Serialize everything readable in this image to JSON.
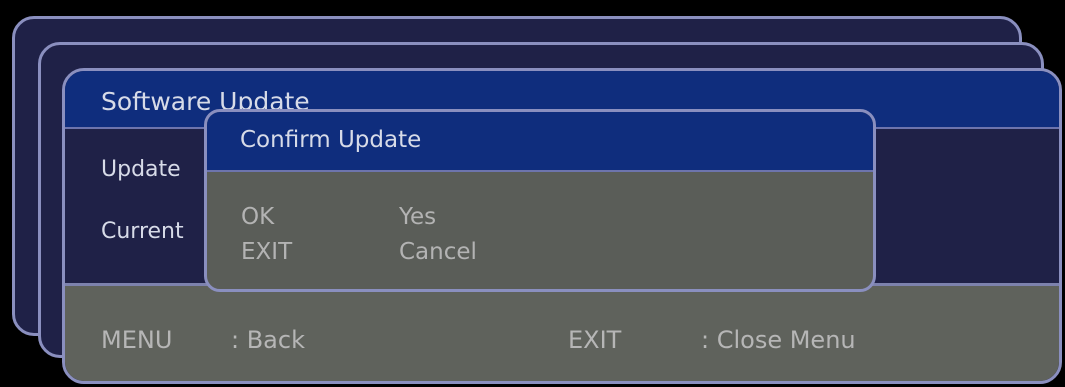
{
  "main_window": {
    "title": "Software Update",
    "rows": [
      "Update",
      "Current"
    ]
  },
  "footer": {
    "menu_key": "MENU",
    "menu_action": ": Back",
    "exit_key": "EXIT",
    "exit_action": ": Close Menu"
  },
  "dialog": {
    "title": "Confirm Update",
    "options": [
      {
        "key": "OK",
        "action": "Yes"
      },
      {
        "key": "EXIT",
        "action": "Cancel"
      }
    ]
  },
  "colors": {
    "background": "#000000",
    "window_body": "#1f2147",
    "title_bar": "#0f2d7d",
    "panel_gray": "#5f625c",
    "border": "#8a8fbf"
  }
}
